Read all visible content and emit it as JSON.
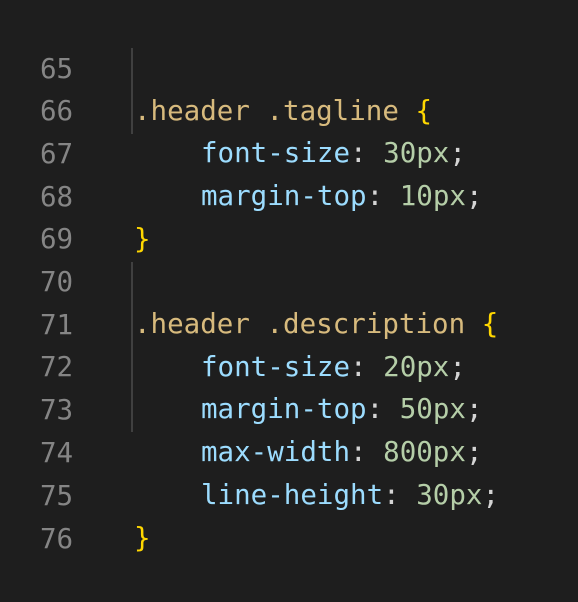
{
  "editor": {
    "lines": [
      {
        "num": "65",
        "selector": ".header .tagline",
        "brace": "{"
      },
      {
        "num": "66",
        "prop": "font-size",
        "colon": ":",
        "value": "30px",
        "semi": ";"
      },
      {
        "num": "67",
        "prop": "margin-top",
        "colon": ":",
        "value": "10px",
        "semi": ";"
      },
      {
        "num": "68",
        "brace": "}"
      },
      {
        "num": "69"
      },
      {
        "num": "70",
        "selector": ".header .description",
        "brace": "{"
      },
      {
        "num": "71",
        "prop": "font-size",
        "colon": ":",
        "value": "20px",
        "semi": ";"
      },
      {
        "num": "72",
        "prop": "margin-top",
        "colon": ":",
        "value": "50px",
        "semi": ";"
      },
      {
        "num": "73",
        "prop": "max-width",
        "colon": ":",
        "value": "800px",
        "semi": ";"
      },
      {
        "num": "74",
        "prop": "line-height",
        "colon": ":",
        "value": "30px",
        "semi": ";"
      },
      {
        "num": "75",
        "brace": "}"
      },
      {
        "num": "76"
      }
    ]
  },
  "colors": {
    "background": "#1e1e1e",
    "line_number": "#858585",
    "selector": "#d7ba7d",
    "brace": "#ffd700",
    "property": "#9cdcfe",
    "value": "#b5cea8"
  }
}
